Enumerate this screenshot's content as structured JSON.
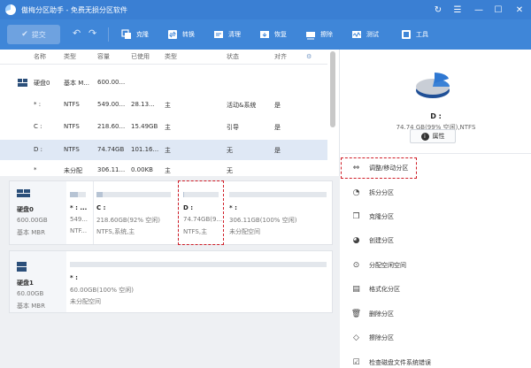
{
  "app": {
    "title": "傲梅分区助手 - 免费无损分区软件"
  },
  "window_controls": {
    "refresh": "↻",
    "menu": "☰",
    "minimize": "—",
    "maximize": "☐",
    "close": "✕"
  },
  "toolbar": {
    "commit": "提交",
    "undo": "↶",
    "redo": "↷",
    "items": [
      {
        "label": "克隆"
      },
      {
        "label": "转换"
      },
      {
        "label": "清理"
      },
      {
        "label": "恢复"
      },
      {
        "label": "擦除"
      },
      {
        "label": "测试"
      },
      {
        "label": "工具"
      }
    ]
  },
  "table": {
    "headers": [
      "名称",
      "类型",
      "容量",
      "已使用",
      "类型",
      "状态",
      "对齐",
      "⚙"
    ],
    "rows": [
      {
        "name": "硬盘0",
        "type": "基本 M...",
        "capacity": "600.00...",
        "used": "",
        "ptype": "",
        "status": "",
        "align": ""
      },
      {
        "name": "* :",
        "type": "NTFS",
        "capacity": "549.00...",
        "used": "28.13...",
        "ptype": "主",
        "status": "活动&系统",
        "align": "是"
      },
      {
        "name": "C :",
        "type": "NTFS",
        "capacity": "218.60...",
        "used": "15.49GB",
        "ptype": "主",
        "status": "引导",
        "align": "是"
      },
      {
        "name": "D :",
        "type": "NTFS",
        "capacity": "74.74GB",
        "used": "101.16...",
        "ptype": "主",
        "status": "无",
        "align": "是"
      },
      {
        "name": "*",
        "type": "未分配",
        "capacity": "306.11...",
        "used": "0.00KB",
        "ptype": "主",
        "status": "无",
        "align": ""
      }
    ]
  },
  "disks": [
    {
      "name": "硬盘0",
      "size": "600.00GB",
      "kind": "基本 MBR",
      "partitions": [
        {
          "name": "* : ...",
          "line1": "549...",
          "line2": "NTF...",
          "used_fraction": 0.5
        },
        {
          "name": "C :",
          "line1": "218.60GB(92% 空闲)",
          "line2": "NTFS,系统,主",
          "used_fraction": 0.08
        },
        {
          "name": "D :",
          "line1": "74.74GB(9...",
          "line2": "NTFS,主",
          "used_fraction": 0.01
        },
        {
          "name": "* :",
          "line1": "306.11GB(100% 空闲)",
          "line2": "未分配空间",
          "used_fraction": 0.0
        }
      ]
    },
    {
      "name": "硬盘1",
      "size": "60.00GB",
      "kind": "基本 MBR",
      "partitions": [
        {
          "name": "* :",
          "line1": "60.00GB(100% 空闲)",
          "line2": "未分配空间",
          "used_fraction": 0.0
        }
      ]
    }
  ],
  "details": {
    "name": "D :",
    "info": "74.74 GB(99% 空闲),NTFS",
    "properties": "属性"
  },
  "operations": [
    {
      "label": "调整/移动分区",
      "icon": "resize-move-icon"
    },
    {
      "label": "拆分分区",
      "icon": "split-partition-icon"
    },
    {
      "label": "克隆分区",
      "icon": "clone-partition-icon"
    },
    {
      "label": "创建分区",
      "icon": "create-partition-icon"
    },
    {
      "label": "分配空闲空间",
      "icon": "allocate-space-icon"
    },
    {
      "label": "格式化分区",
      "icon": "format-partition-icon"
    },
    {
      "label": "删除分区",
      "icon": "delete-partition-icon"
    },
    {
      "label": "擦除分区",
      "icon": "wipe-partition-icon"
    },
    {
      "label": "检查磁盘文件系统错误",
      "icon": "check-disk-icon"
    }
  ],
  "colors": {
    "titlebar": "#3a7fd3",
    "toolbar": "#3f86d8",
    "highlight": "#d01d27",
    "selected_row": "#dfe8f5"
  }
}
